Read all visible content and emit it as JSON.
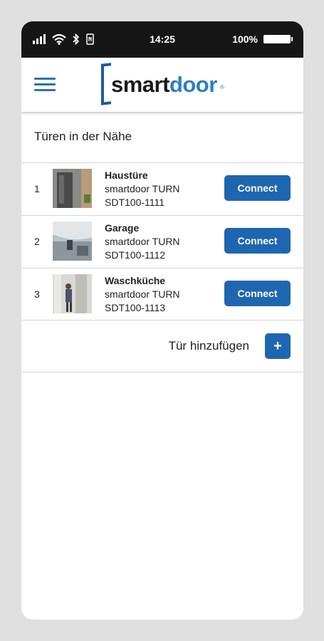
{
  "status_bar": {
    "time": "14:25",
    "battery": "100%",
    "icons": [
      "signal-icon",
      "wifi-icon",
      "bluetooth-icon",
      "nfc-icon"
    ]
  },
  "app_bar": {
    "menu_icon": "hamburger-menu-icon",
    "logo": {
      "part1": "smart",
      "part2": "door",
      "reg": "®"
    }
  },
  "section_title": "Türen in der Nähe",
  "doors": [
    {
      "index": "1",
      "name": "Haustüre",
      "model": "smartdoor TURN",
      "serial": "SDT100-1111",
      "button": "Connect"
    },
    {
      "index": "2",
      "name": "Garage",
      "model": "smartdoor TURN",
      "serial": "SDT100-1112",
      "button": "Connect"
    },
    {
      "index": "3",
      "name": "Waschküche",
      "model": "smartdoor TURN",
      "serial": "SDT100-1113",
      "button": "Connect"
    }
  ],
  "add_door": {
    "label": "Tür hinzufügen",
    "button": "+"
  },
  "colors": {
    "accent": "#1f66b0",
    "logo_blue": "#2d7fc1",
    "status_bar": "#161616",
    "background": "#e0e0e0"
  }
}
